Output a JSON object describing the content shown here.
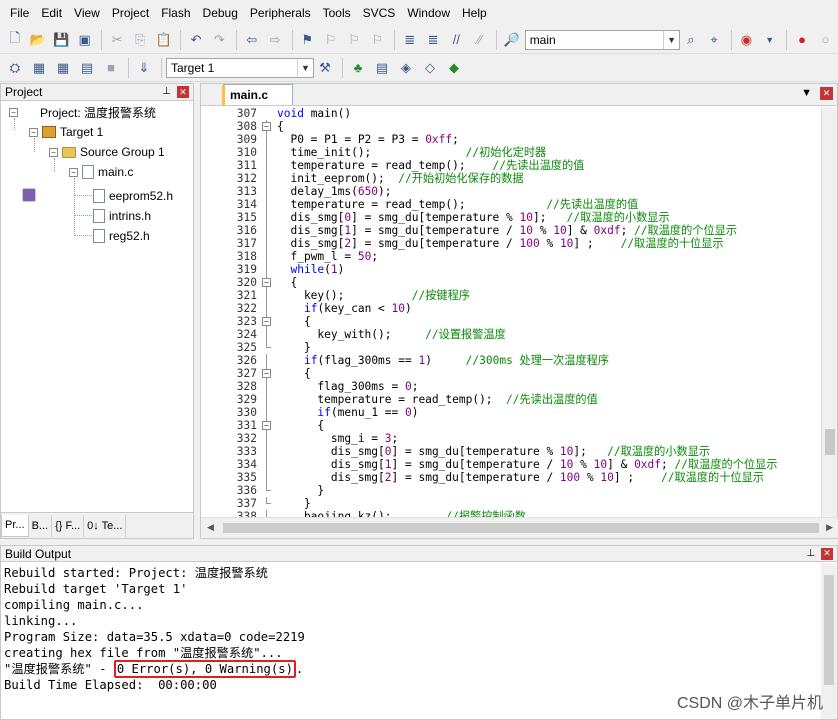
{
  "menu": [
    "File",
    "Edit",
    "View",
    "Project",
    "Flash",
    "Debug",
    "Peripherals",
    "Tools",
    "SVCS",
    "Window",
    "Help"
  ],
  "toolbar": {
    "find_combo": "main",
    "target_combo": "Target 1"
  },
  "project_panel": {
    "title": "Project",
    "project_label": "Project: 温度报警系统",
    "target_label": "Target 1",
    "group_label": "Source Group 1",
    "file_main": "main.c",
    "includes": [
      "eeprom52.h",
      "intrins.h",
      "reg52.h"
    ],
    "tabs": [
      "Pr...",
      "B...",
      "{} F...",
      "0↓ Te..."
    ]
  },
  "editor": {
    "tab": "main.c",
    "lines": [
      {
        "n": "307",
        "t": "void main()"
      },
      {
        "n": "308",
        "t": "{"
      },
      {
        "n": "309",
        "t": "  P0 = P1 = P2 = P3 = 0xff;"
      },
      {
        "n": "310",
        "t": "  time_init();",
        "c": "//初始化定时器",
        "pad": "              "
      },
      {
        "n": "311",
        "t": "  temperature = read_temp();",
        "c": "//先读出温度的值",
        "pad": "    "
      },
      {
        "n": "312",
        "t": "  init_eeprom();",
        "c": "//开始初始化保存的数据",
        "pad": "  "
      },
      {
        "n": "313",
        "t": "  delay_1ms(650);"
      },
      {
        "n": "314",
        "t": "  temperature = read_temp();",
        "c": "//先读出温度的值",
        "pad": "            "
      },
      {
        "n": "315",
        "t": "  dis_smg[0] = smg_du[temperature % 10];",
        "c": "//取温度的小数显示",
        "pad": "   "
      },
      {
        "n": "316",
        "t": "  dis_smg[1] = smg_du[temperature / 10 % 10] & 0xdf;",
        "c": "//取温度的个位显示",
        "pad": " "
      },
      {
        "n": "317",
        "t": "  dis_smg[2] = smg_du[temperature / 100 % 10] ;",
        "c": "//取温度的十位显示",
        "pad": "    "
      },
      {
        "n": "318",
        "t": "  f_pwm_l = 50;"
      },
      {
        "n": "319",
        "t": "  while(1)"
      },
      {
        "n": "320",
        "t": "  {"
      },
      {
        "n": "321",
        "t": "    key();",
        "c": "//按键程序",
        "pad": "          "
      },
      {
        "n": "322",
        "t": "    if(key_can < 10)"
      },
      {
        "n": "323",
        "t": "    {"
      },
      {
        "n": "324",
        "t": "      key_with();",
        "c": "//设置报警温度",
        "pad": "     "
      },
      {
        "n": "325",
        "t": "    }"
      },
      {
        "n": "326",
        "t": "    if(flag_300ms == 1)",
        "c": "//300ms 处理一次温度程序",
        "pad": "     "
      },
      {
        "n": "327",
        "t": "    {"
      },
      {
        "n": "328",
        "t": "      flag_300ms = 0;"
      },
      {
        "n": "329",
        "t": "      temperature = read_temp();",
        "c": "//先读出温度的值",
        "pad": "  "
      },
      {
        "n": "330",
        "t": "      if(menu_1 == 0)"
      },
      {
        "n": "331",
        "t": "      {"
      },
      {
        "n": "332",
        "t": "        smg_i = 3;"
      },
      {
        "n": "333",
        "t": "        dis_smg[0] = smg_du[temperature % 10];",
        "c": "//取温度的小数显示",
        "pad": "   "
      },
      {
        "n": "334",
        "t": "        dis_smg[1] = smg_du[temperature / 10 % 10] & 0xdf;",
        "c": "//取温度的个位显示",
        "pad": " "
      },
      {
        "n": "335",
        "t": "        dis_smg[2] = smg_du[temperature / 100 % 10] ;",
        "c": "//取温度的十位显示",
        "pad": "    "
      },
      {
        "n": "336",
        "t": "      }"
      },
      {
        "n": "337",
        "t": "    }"
      },
      {
        "n": "338",
        "t": "    baojing_kz();",
        "c": "//报警控制函数",
        "pad": "        "
      }
    ]
  },
  "build_output": {
    "title": "Build Output",
    "lines": [
      "Rebuild started: Project: 温度报警系统",
      "Rebuild target 'Target 1'",
      "compiling main.c...",
      "linking...",
      "Program Size: data=35.5 xdata=0 code=2219",
      "creating hex file from \"温度报警系统\"..."
    ],
    "result_prefix": "\"温度报警系统\" - ",
    "result_highlight": "0 Error(s), 0 Warning(s)",
    "result_suffix": ".",
    "elapsed": "Build Time Elapsed:  00:00:00"
  },
  "watermark": "CSDN @木子单片机",
  "colors": {
    "keyword": "#0000ff",
    "comment": "#0a8a0a",
    "highlight_box": "#e02020"
  }
}
